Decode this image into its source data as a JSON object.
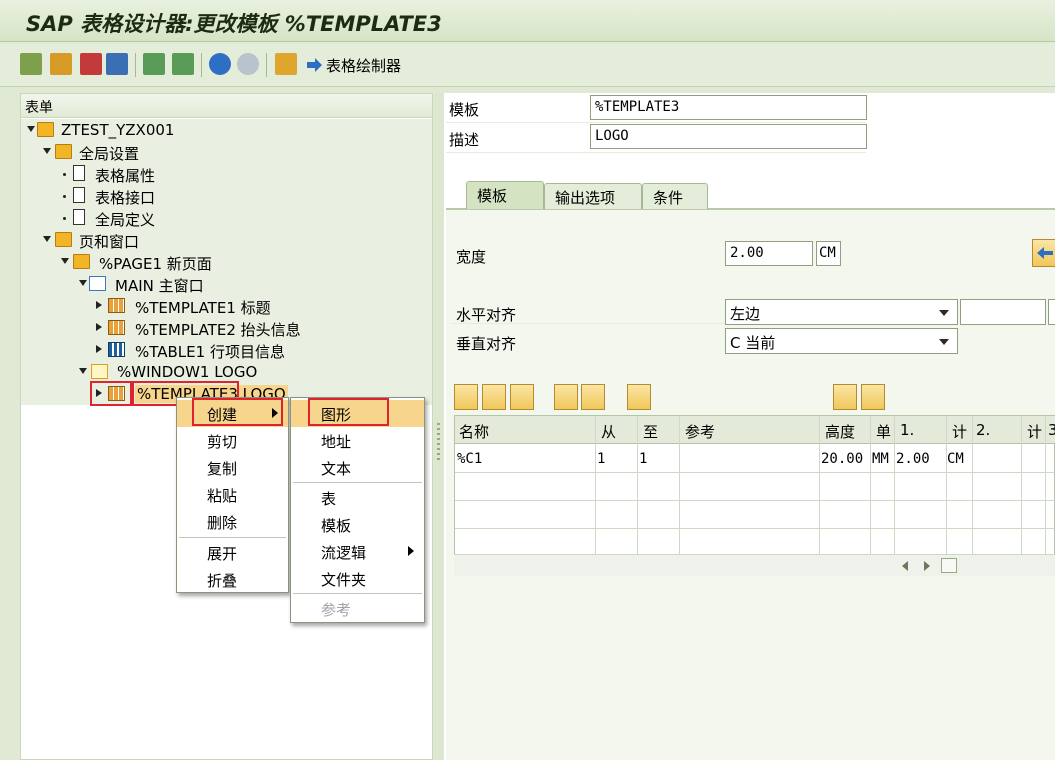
{
  "window": {
    "title": "SAP 表格设计器:更改模板 %TEMPLATE3"
  },
  "toolbar": {
    "form_painter_label": "表格绘制器"
  },
  "tree": {
    "header": "表单",
    "nodes": [
      {
        "label": "ZTEST_YZX001"
      },
      {
        "label": "全局设置"
      },
      {
        "label": "表格属性"
      },
      {
        "label": "表格接口"
      },
      {
        "label": "全局定义"
      },
      {
        "label": "页和窗口"
      },
      {
        "label": "%PAGE1 新页面"
      },
      {
        "label": "MAIN 主窗口"
      },
      {
        "label": "%TEMPLATE1 标题"
      },
      {
        "label": "%TEMPLATE2 抬头信息"
      },
      {
        "label": "%TABLE1 行项目信息"
      },
      {
        "label": "%WINDOW1 LOGO"
      },
      {
        "label": "%TEMPLATE3 LOGO"
      }
    ]
  },
  "details": {
    "template_label": "模板",
    "template_value": "%TEMPLATE3",
    "desc_label": "描述",
    "desc_value": "LOGO"
  },
  "tabs": [
    "模板",
    "输出选项",
    "条件"
  ],
  "tab_template": {
    "width_label": "宽度",
    "width_value": "2.00",
    "width_unit": "CM",
    "halign_label": "水平对齐",
    "halign_value": "左边",
    "valign_label": "垂直对齐",
    "valign_value": "C 当前"
  },
  "grid": {
    "headers": [
      "名称",
      "从",
      "至",
      "参考",
      "高度",
      "单",
      "1.",
      "计",
      "2.",
      "计",
      "3"
    ],
    "rows": [
      {
        "name": "%C1",
        "from": "1",
        "to": "1",
        "ref": "",
        "height": "20.00",
        "unit": "MM",
        "c1": "2.00",
        "u1": "CM"
      }
    ]
  },
  "context_menu": {
    "items": [
      "创建",
      "剪切",
      "复制",
      "粘贴",
      "删除",
      "展开",
      "折叠"
    ]
  },
  "submenu": {
    "items": [
      "图形",
      "地址",
      "文本",
      "表",
      "模板",
      "流逻辑",
      "文件夹",
      "参考"
    ]
  }
}
